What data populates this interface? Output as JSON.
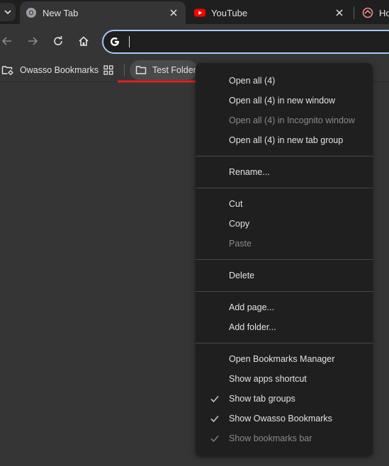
{
  "tabs": [
    {
      "title": "New Tab",
      "favicon": "chrome-icon",
      "active": true
    },
    {
      "title": "YouTube",
      "favicon": "youtube-icon",
      "active": false
    },
    {
      "title": "Ho",
      "favicon": "app-icon",
      "active": false
    }
  ],
  "toolbar": {
    "omnibox_value": "",
    "search_engine_icon": "google-g-icon"
  },
  "bookmarks": {
    "owasso_label": "Owasso Bookmarks",
    "folder_label": "Test Folder"
  },
  "menu": {
    "group1": [
      {
        "label": "Open all (4)",
        "disabled": false
      },
      {
        "label": "Open all (4) in new window",
        "disabled": false
      },
      {
        "label": "Open all (4) in Incognito window",
        "disabled": true
      },
      {
        "label": "Open all (4) in new tab group",
        "disabled": false
      }
    ],
    "group2": [
      {
        "label": "Rename...",
        "disabled": false
      }
    ],
    "group3": [
      {
        "label": "Cut",
        "disabled": false
      },
      {
        "label": "Copy",
        "disabled": false
      },
      {
        "label": "Paste",
        "disabled": true
      }
    ],
    "group4": [
      {
        "label": "Delete",
        "disabled": false
      }
    ],
    "group5": [
      {
        "label": "Add page...",
        "disabled": false
      },
      {
        "label": "Add folder...",
        "disabled": false
      }
    ],
    "group6": [
      {
        "label": "Open Bookmarks Manager",
        "checked": false,
        "disabled": false
      },
      {
        "label": "Show apps shortcut",
        "checked": false,
        "disabled": false
      },
      {
        "label": "Show tab groups",
        "checked": true,
        "disabled": false
      },
      {
        "label": "Show Owasso Bookmarks",
        "checked": true,
        "disabled": false
      },
      {
        "label": "Show bookmarks bar",
        "checked": true,
        "disabled": true
      }
    ]
  },
  "colors": {
    "annotation_arrow": "#e02020",
    "omnibox_focus_ring": "#a8c7fa",
    "menu_bg": "#1f1f1f"
  }
}
